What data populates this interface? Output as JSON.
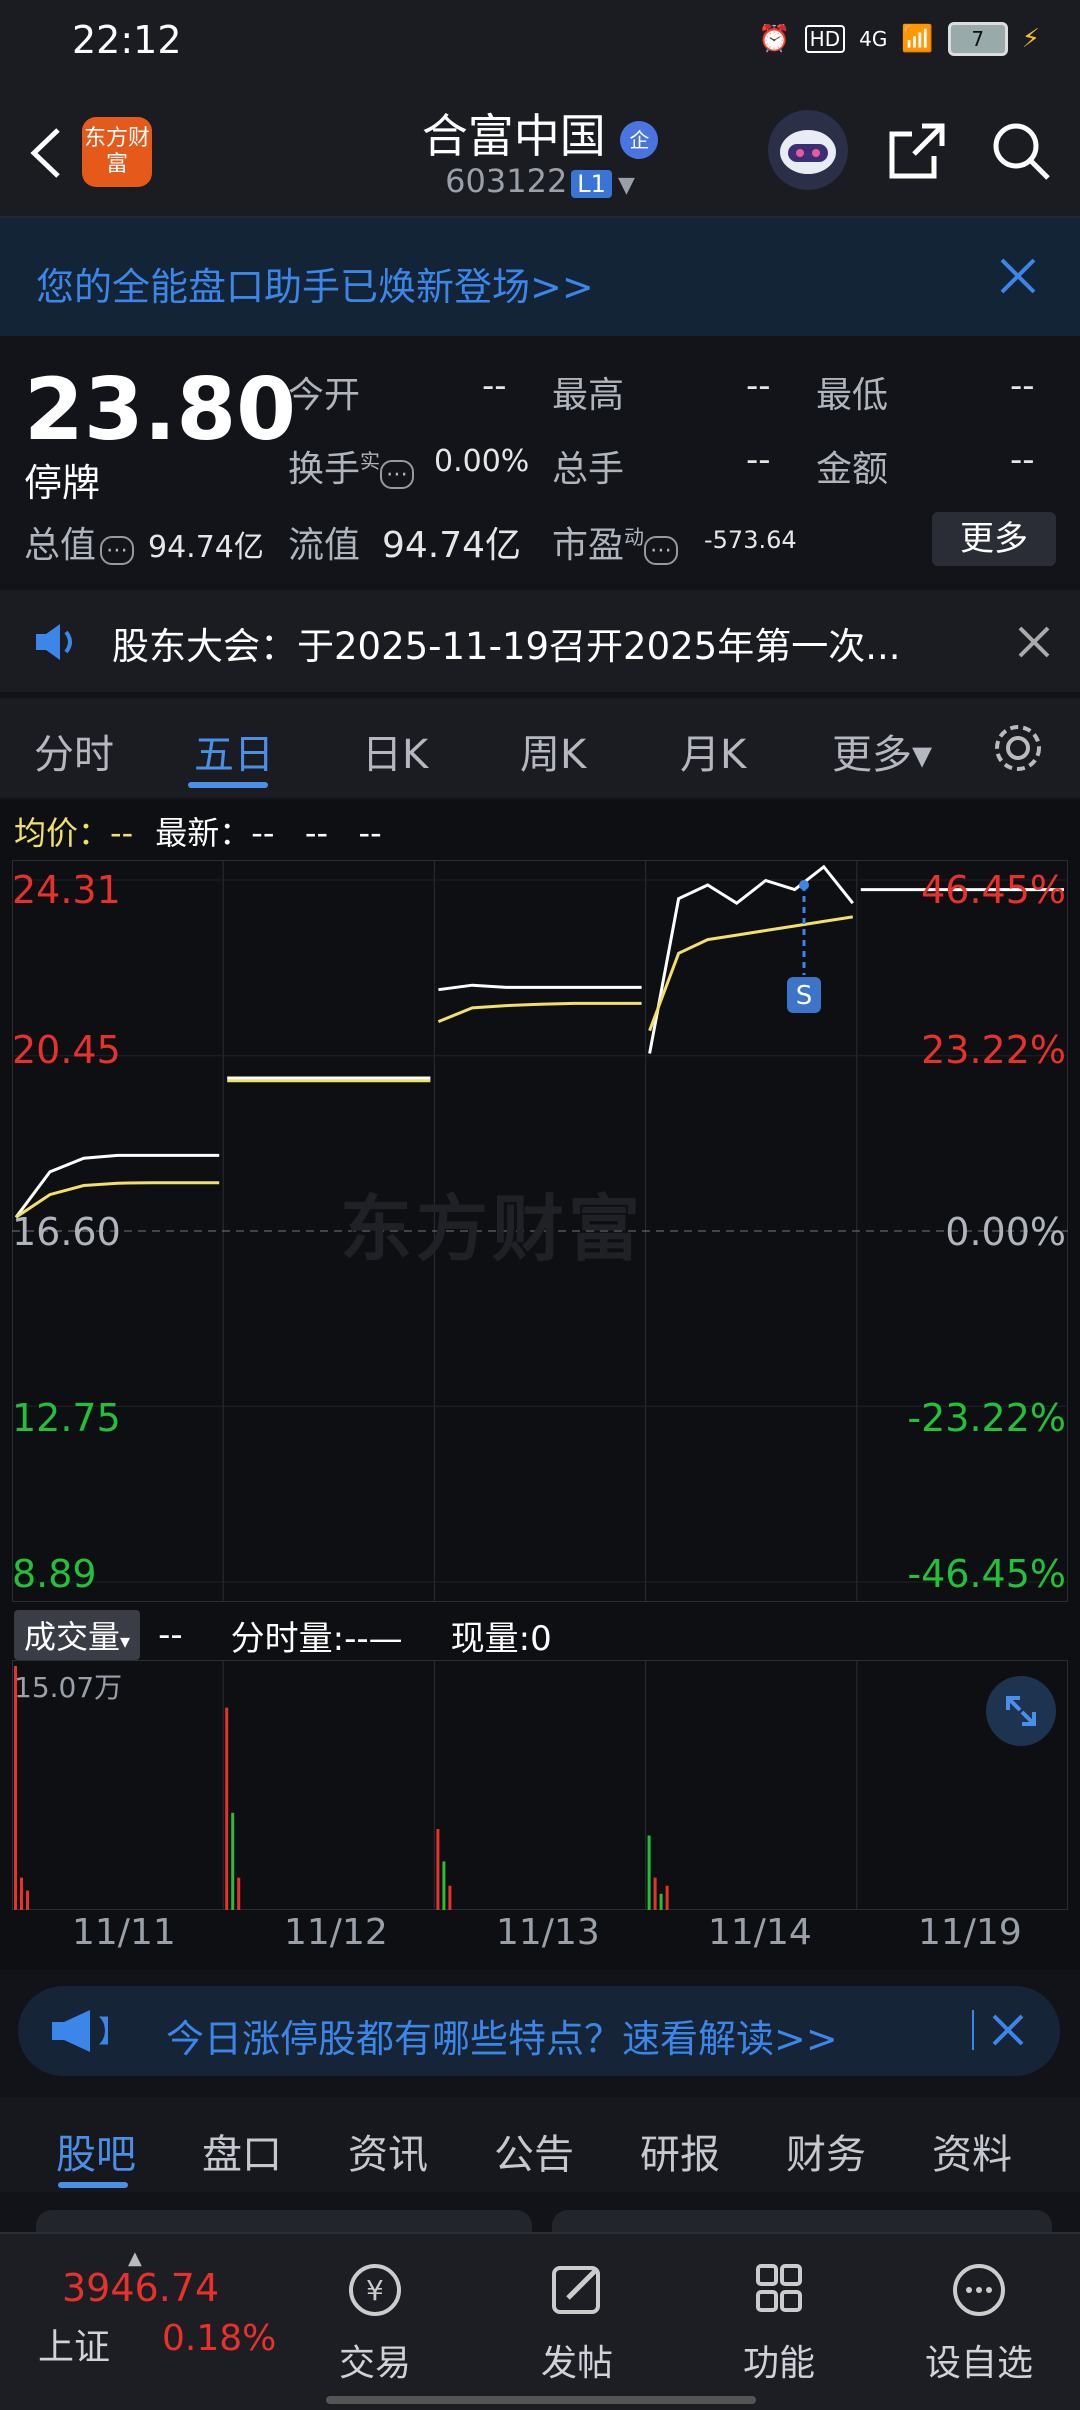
{
  "status_bar": {
    "time": "22:12",
    "battery": "7",
    "network": "4G",
    "hd": "HD"
  },
  "header": {
    "logo_text": "东方财富",
    "title": "合富中国",
    "badge": "企",
    "code": "603122",
    "level": "L1"
  },
  "banner": {
    "text": "您的全能盘口助手已焕新登场>>"
  },
  "quote": {
    "price": "23.80",
    "status": "停牌",
    "rows": [
      {
        "label": "今开",
        "value": "--"
      },
      {
        "label": "最高",
        "value": "--"
      },
      {
        "label": "最低",
        "value": "--"
      },
      {
        "label": "换手",
        "sup": "实",
        "value": "0.00%"
      },
      {
        "label": "总手",
        "value": "--"
      },
      {
        "label": "金额",
        "value": "--"
      }
    ],
    "total_value_label": "总值",
    "total_value": "94.74亿",
    "float_value_label": "流值",
    "float_value": "94.74亿",
    "pe_label": "市盈",
    "pe_sup": "动",
    "pe_value": "-573.64",
    "more": "更多"
  },
  "notice": {
    "text": "股东大会：于2025-11-19召开2025年第一次..."
  },
  "tabs": [
    "分时",
    "五日",
    "日K",
    "周K",
    "月K",
    "更多▾"
  ],
  "chart_legend": {
    "avg_label": "均价：",
    "avg_value": "--",
    "latest_label": "最新：",
    "latest_values": "--   --   --"
  },
  "chart_data": {
    "type": "line",
    "x": [
      "11/11",
      "11/12",
      "11/13",
      "11/14",
      "11/19"
    ],
    "y_ticks_left": [
      "24.31",
      "20.45",
      "16.60",
      "12.75",
      "8.89"
    ],
    "y_ticks_right": [
      "46.45%",
      "23.22%",
      "0.00%",
      "-23.22%",
      "-46.45%"
    ],
    "ylim": [
      8.89,
      24.31
    ],
    "base_price": 16.6,
    "series": [
      {
        "name": "最新",
        "color": "#ffffff",
        "days": [
          [
            16.9,
            17.9,
            18.2,
            18.26,
            18.26,
            18.26,
            18.26
          ],
          [
            19.96,
            19.96,
            19.96,
            19.96,
            19.96,
            19.96,
            19.96
          ],
          [
            21.9,
            22.0,
            21.95,
            21.95,
            21.95,
            21.95,
            21.95
          ],
          [
            20.5,
            23.9,
            24.2,
            23.8,
            24.3,
            24.1,
            24.6,
            23.8
          ],
          [
            24.1,
            24.1
          ]
        ]
      },
      {
        "name": "均价",
        "color": "#f2e06b",
        "days": [
          [
            16.9,
            17.4,
            17.6,
            17.65,
            17.66,
            17.66,
            17.66
          ],
          [
            19.9,
            19.9,
            19.9,
            19.9,
            19.9,
            19.9,
            19.9
          ],
          [
            21.2,
            21.5,
            21.55,
            21.58,
            21.6,
            21.6,
            21.6
          ],
          [
            21.0,
            22.7,
            23.0,
            23.1,
            23.2,
            23.3,
            23.4,
            23.5
          ],
          []
        ]
      }
    ],
    "marker": {
      "label": "S",
      "day": 3,
      "price": 24.2
    }
  },
  "volume": {
    "selector": "成交量",
    "value1": "--",
    "label2": "分时量:",
    "value2": "--—",
    "label3": "现量:",
    "value3": "0",
    "max_label": "15.07万"
  },
  "volume_data": [
    [
      {
        "v": 15.07,
        "c": "red"
      },
      {
        "v": 2.0,
        "c": "red"
      },
      {
        "v": 1.2,
        "c": "red"
      }
    ],
    [
      {
        "v": 12.5,
        "c": "red"
      },
      {
        "v": 6.0,
        "c": "green"
      },
      {
        "v": 2.0,
        "c": "red"
      }
    ],
    [
      {
        "v": 5.0,
        "c": "red"
      },
      {
        "v": 3.0,
        "c": "green"
      },
      {
        "v": 1.5,
        "c": "red"
      }
    ],
    [
      {
        "v": 4.6,
        "c": "green"
      },
      {
        "v": 2.0,
        "c": "red"
      },
      {
        "v": 1.0,
        "c": "green"
      },
      {
        "v": 1.5,
        "c": "red"
      }
    ],
    []
  ],
  "promo": {
    "text": "今日涨停股都有哪些特点？速看解读>>"
  },
  "bottom_tabs": [
    "股吧",
    "盘口",
    "资讯",
    "公告",
    "研报",
    "财务",
    "资料"
  ],
  "bottom_bar": {
    "index_value": "3946.74",
    "index_name": "上证",
    "index_change": "0.18%",
    "items": [
      {
        "label": "交易",
        "icon": "trade-icon"
      },
      {
        "label": "发帖",
        "icon": "post-icon"
      },
      {
        "label": "功能",
        "icon": "function-icon"
      },
      {
        "label": "设自选",
        "icon": "more-icon"
      }
    ]
  },
  "colors": {
    "accent": "#4a8fe8",
    "up": "#e8312a",
    "down": "#23c13a",
    "avg_line": "#f2e06b"
  }
}
